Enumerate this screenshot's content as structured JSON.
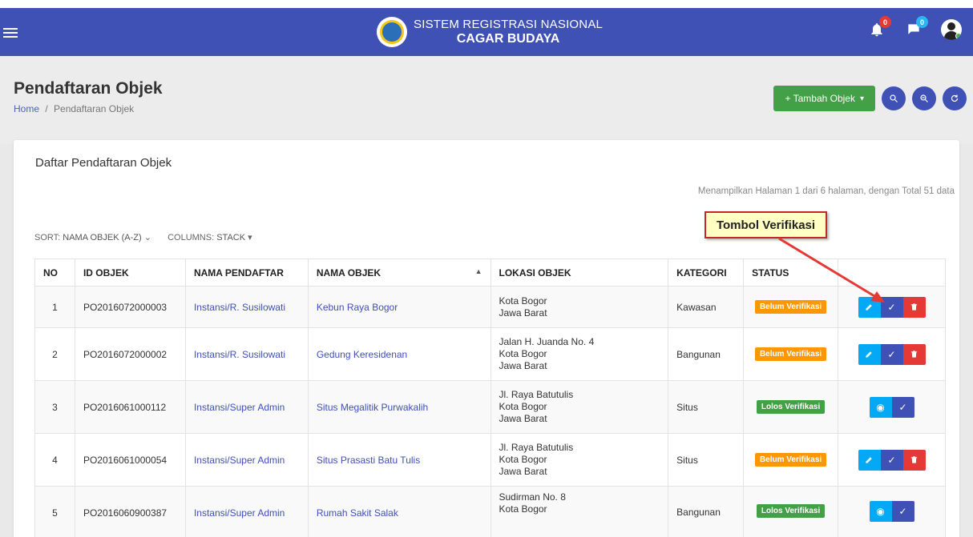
{
  "app": {
    "title_line1": "SISTEM REGISTRASI NASIONAL",
    "title_line2": "CAGAR BUDAYA",
    "notif_count": "0",
    "msg_count": "0"
  },
  "page": {
    "title": "Pendaftaran Objek",
    "breadcrumb_home": "Home",
    "breadcrumb_sep": "/",
    "breadcrumb_current": "Pendaftaran Objek",
    "add_button": "+ Tambah Objek",
    "add_caret": "▾"
  },
  "card": {
    "title": "Daftar Pendaftaran Objek",
    "summary": "Menampilkan Halaman 1 dari 6 halaman, dengan Total 51 data",
    "sort_label": "SORT:",
    "sort_value": "NAMA OBJEK (A-Z)",
    "columns_label": "COLUMNS:",
    "columns_value": "STACK"
  },
  "table": {
    "headers": {
      "no": "NO",
      "id": "ID OBJEK",
      "pendaftar": "NAMA PENDAFTAR",
      "objek": "NAMA OBJEK",
      "lokasi": "LOKASI OBJEK",
      "kategori": "KATEGORI",
      "status": "STATUS"
    },
    "rows": [
      {
        "no": "1",
        "id": "PO2016072000003",
        "pendaftar": "Instansi/R. Susilowati",
        "objek": "Kebun Raya Bogor",
        "lokasi": [
          "Kota Bogor",
          "Jawa Barat"
        ],
        "kategori": "Kawasan",
        "status": "Belum Verifikasi"
      },
      {
        "no": "2",
        "id": "PO2016072000002",
        "pendaftar": "Instansi/R. Susilowati",
        "objek": "Gedung Keresidenan",
        "lokasi": [
          "Jalan H. Juanda No. 4",
          "Kota Bogor",
          "Jawa Barat"
        ],
        "kategori": "Bangunan",
        "status": "Belum Verifikasi"
      },
      {
        "no": "3",
        "id": "PO2016061000112",
        "pendaftar": "Instansi/Super Admin",
        "objek": "Situs Megalitik Purwakalih",
        "lokasi": [
          "Jl. Raya Batutulis",
          "Kota Bogor",
          "Jawa Barat"
        ],
        "kategori": "Situs",
        "status": "Lolos Verifikasi"
      },
      {
        "no": "4",
        "id": "PO2016061000054",
        "pendaftar": "Instansi/Super Admin",
        "objek": "Situs Prasasti Batu Tulis",
        "lokasi": [
          "Jl. Raya Batutulis",
          "Kota Bogor",
          "Jawa Barat"
        ],
        "kategori": "Situs",
        "status": "Belum Verifikasi"
      },
      {
        "no": "5",
        "id": "PO2016060900387",
        "pendaftar": "Instansi/Super Admin",
        "objek": "Rumah Sakit Salak",
        "lokasi": [
          "Sudirman No. 8",
          "Kota Bogor"
        ],
        "kategori": "Bangunan",
        "status": "Lolos Verifikasi"
      }
    ]
  },
  "callout": {
    "text": "Tombol Verifikasi"
  },
  "colors": {
    "primary": "#3f51b5",
    "success": "#43a047",
    "warning": "#ff9800",
    "danger": "#e53935",
    "info": "#03a9f4"
  },
  "icons": [
    "menu-icon",
    "cagar-budaya-logo",
    "bell-icon",
    "chat-icon",
    "avatar",
    "search-icon",
    "advanced-search-icon",
    "refresh-icon",
    "pencil-icon",
    "check-icon",
    "trash-icon",
    "eye-icon",
    "sort-caret-icon"
  ]
}
